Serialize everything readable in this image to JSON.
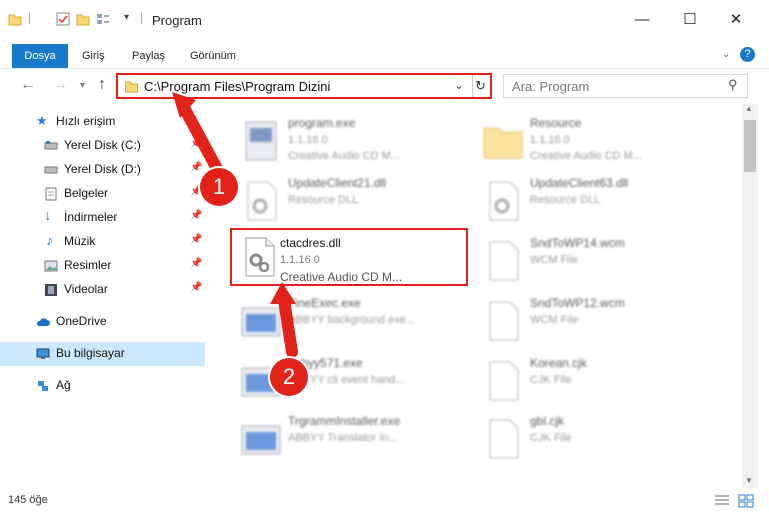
{
  "window": {
    "title": "Program",
    "quick_access_icons": [
      "folder-icon",
      "properties-icon",
      "new-folder-icon"
    ],
    "minimize": "—",
    "maximize": "☐",
    "close": "✕"
  },
  "ribbon": {
    "tabs": [
      "Dosya",
      "Giriş",
      "Paylaş",
      "Görünüm"
    ]
  },
  "nav": {
    "address": "C:\\Program Files\\Program Dizini",
    "search_placeholder": "Ara: Program"
  },
  "sidebar": {
    "items": [
      {
        "label": "Hızlı erişim",
        "icon": "star-icon"
      },
      {
        "label": "Yerel Disk (C:)",
        "icon": "drive-icon"
      },
      {
        "label": "Yerel Disk (D:)",
        "icon": "drive-icon"
      },
      {
        "label": "Belgeler",
        "icon": "documents-icon"
      },
      {
        "label": "İndirmeler",
        "icon": "download-icon"
      },
      {
        "label": "Müzik",
        "icon": "music-icon"
      },
      {
        "label": "Resimler",
        "icon": "pictures-icon"
      },
      {
        "label": "Videolar",
        "icon": "videos-icon"
      },
      {
        "label": "OneDrive",
        "icon": "cloud-icon"
      },
      {
        "label": "Bu bilgisayar",
        "icon": "computer-icon"
      },
      {
        "label": "Ağ",
        "icon": "network-icon"
      }
    ]
  },
  "files": [
    {
      "name": "program.exe",
      "line2": "1.1.16.0",
      "line3": "Creative Audio CD M..."
    },
    {
      "name": "Resource",
      "line2": "1.1.16.0",
      "line3": "Creative Audio CD M..."
    },
    {
      "name": "UpdateClient21.dll",
      "line2": "Resource DLL",
      "line3": ""
    },
    {
      "name": "UpdateClient63.dll",
      "line2": "Resource DLL",
      "line3": ""
    },
    {
      "name": "ctacdres.dll",
      "line2": "1.1.16.0",
      "line3": "Creative Audio CD M..."
    },
    {
      "name": "SndToWP14.wcm",
      "line2": "WCM File",
      "line3": ""
    },
    {
      "name": "FineExec.exe",
      "line2": "ABBYY background exe...",
      "line3": ""
    },
    {
      "name": "SndToWP12.wcm",
      "line2": "WCM File",
      "line3": ""
    },
    {
      "name": "abbyy571.exe",
      "line2": "ABBYY cli event hand...",
      "line3": ""
    },
    {
      "name": "Korean.cjk",
      "line2": "CJK File",
      "line3": ""
    },
    {
      "name": "TrgrammInstaller.exe",
      "line2": "ABBYY Translator In...",
      "line3": ""
    },
    {
      "name": "gbl.cjk",
      "line2": "CJK File",
      "line3": ""
    }
  ],
  "status": {
    "item_count": "145 öğe"
  },
  "callouts": [
    "1",
    "2"
  ],
  "colors": {
    "accent": "#1979ca",
    "highlight": "#e2231a",
    "selection": "#cce8ff"
  }
}
